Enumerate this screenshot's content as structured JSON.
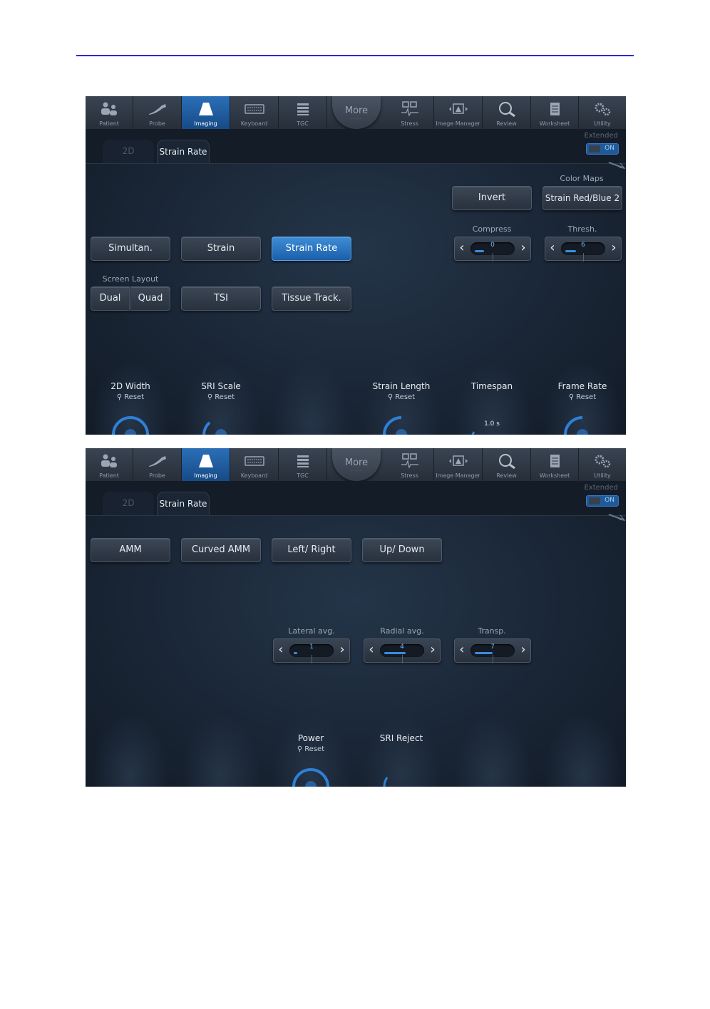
{
  "nav": {
    "items": [
      {
        "label": "Patient",
        "icon": "patient-icon"
      },
      {
        "label": "Probe",
        "icon": "probe-icon"
      },
      {
        "label": "Imaging",
        "icon": "imaging-icon"
      },
      {
        "label": "Keyboard",
        "icon": "keyboard-icon"
      },
      {
        "label": "TGC",
        "icon": "tgc-icon"
      },
      {
        "label": "Stress",
        "icon": "stress-icon"
      },
      {
        "label": "Image Manager",
        "icon": "image-manager-icon"
      },
      {
        "label": "Review",
        "icon": "review-icon"
      },
      {
        "label": "Worksheet",
        "icon": "worksheet-icon"
      },
      {
        "label": "Utility",
        "icon": "utility-icon"
      }
    ],
    "more_label": "More",
    "more_dots": "....."
  },
  "tabs": {
    "tab1": "2D",
    "tab2": "Strain Rate"
  },
  "extended": {
    "label": "Extended",
    "toggle": "ON"
  },
  "screen1": {
    "buttons": {
      "invert": "Invert",
      "color_map": "Strain Red/Blue 2",
      "simultan": "Simultan.",
      "strain": "Strain",
      "strain_rate": "Strain Rate",
      "dual": "Dual",
      "quad": "Quad",
      "tsi": "TSI",
      "tissue_track": "Tissue Track."
    },
    "captions": {
      "color_maps": "Color Maps",
      "compress": "Compress",
      "thresh": "Thresh.",
      "screen_layout": "Screen Layout"
    },
    "steppers": {
      "compress": {
        "value": "0",
        "level": 0.25
      },
      "thresh": {
        "value": "6",
        "level": 0.3
      }
    },
    "knobs": {
      "width_2d": {
        "label": "2D Width",
        "reset": "Reset"
      },
      "sri_scale": {
        "label": "SRI Scale",
        "reset": "Reset"
      },
      "strain_length": {
        "label": "Strain Length",
        "reset": "Reset"
      },
      "timespan": {
        "label": "Timespan",
        "value": "1.0 s"
      },
      "frame_rate": {
        "label": "Frame Rate",
        "reset": "Reset"
      }
    }
  },
  "screen2": {
    "buttons": {
      "amm": "AMM",
      "curved_amm": "Curved AMM",
      "left_right": "Left/ Right",
      "up_down": "Up/ Down"
    },
    "captions": {
      "lateral_avg": "Lateral avg.",
      "radial_avg": "Radial avg.",
      "transp": "Transp."
    },
    "steppers": {
      "lateral_avg": {
        "value": "1",
        "level": 0.1
      },
      "radial_avg": {
        "value": "4",
        "level": 0.6
      },
      "transp": {
        "value": "7",
        "level": 0.5
      }
    },
    "knobs": {
      "power": {
        "label": "Power",
        "reset": "Reset"
      },
      "sri_reject": {
        "label": "SRI Reject"
      }
    }
  },
  "colors": {
    "accent": "#2b6fb8",
    "background": "#1a2636"
  }
}
